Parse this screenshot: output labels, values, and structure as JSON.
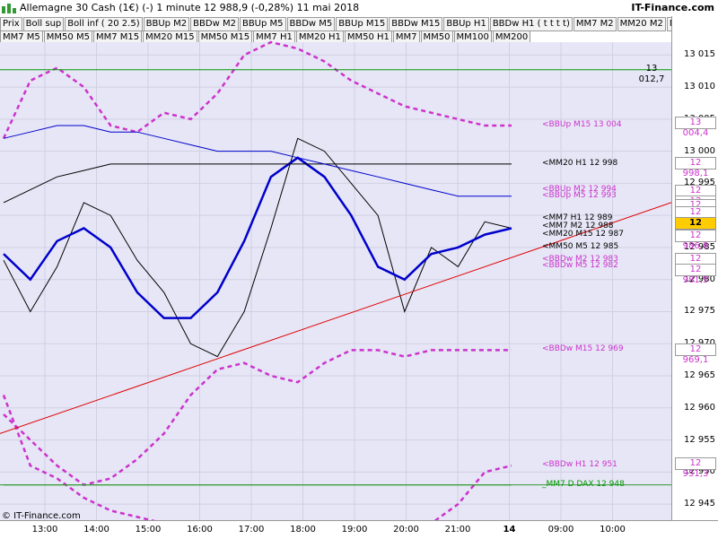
{
  "header": {
    "title": "Allemagne 30 Cash (1€) (-)   1 minute   12 988,9 (-0,28%)   11 mai 2018",
    "brand": "IT-Finance.com"
  },
  "legend_row1": [
    "Prix",
    "Boll sup",
    "Boll inf ( 20 2.5)",
    "BBUp M2",
    "BBDw M2",
    "BBUp M5",
    "BBDw M5",
    "BBUp M15",
    "BBDw M15",
    "BBUp H1",
    "BBDw H1 ( t t t t)",
    "MM7 M2",
    "MM20 M2",
    "MM50 M2"
  ],
  "legend_row2": [
    "MM7 M5",
    "MM50 M5",
    "MM7 M15",
    "MM20 M15",
    "MM50 M15",
    "MM7 H1",
    "MM20 H1",
    "MM50 H1",
    "MM7",
    "MM50",
    "MM100",
    "MM200"
  ],
  "copyright": "© IT-Finance.com",
  "colors": {
    "plot_bg": "#e6e6f6",
    "boll_band_up": "#b08a8a",
    "boll_band_dn": "#a8cfa8",
    "bb_m15": "#cc33cc",
    "mm_blue": "#0000cc",
    "trend_red": "#e00000",
    "hline_green": "#339933",
    "current_price_bg": "#ffcc00"
  },
  "chart_data": {
    "type": "line",
    "title": "Allemagne 30 Cash (1€) (-)",
    "timeframe": "1 minute",
    "last_price": "12 988,9",
    "change_pct": "-0,28%",
    "date": "11 mai 2018",
    "yticks": [
      {
        "label": "13 015",
        "v": 13015
      },
      {
        "label": "13 010",
        "v": 13010
      },
      {
        "label": "13 005",
        "v": 13005
      },
      {
        "label": "13 000",
        "v": 13000
      },
      {
        "label": "12 995",
        "v": 12995
      },
      {
        "label": "12 990",
        "v": 12990
      },
      {
        "label": "12 985",
        "v": 12985
      },
      {
        "label": "12 980",
        "v": 12980
      },
      {
        "label": "12 975",
        "v": 12975
      },
      {
        "label": "12 970",
        "v": 12970
      },
      {
        "label": "12 965",
        "v": 12965
      },
      {
        "label": "12 960",
        "v": 12960
      },
      {
        "label": "12 955",
        "v": 12955
      },
      {
        "label": "12 950",
        "v": 12950
      },
      {
        "label": "12 945",
        "v": 12945
      }
    ],
    "xticks": [
      "13:00",
      "14:00",
      "15:00",
      "16:00",
      "17:00",
      "18:00",
      "19:00",
      "20:00",
      "21:00",
      "14",
      "09:00",
      "10:00"
    ],
    "ylim": [
      12942.5,
      13017.0
    ],
    "right_axis_values": [
      {
        "label": "13 012,7",
        "v": 13012.7
      },
      {
        "label": "13 004,4",
        "v": 13004.4
      },
      {
        "label": "12 998,1",
        "v": 12998.1
      },
      {
        "label": "12 993,8",
        "v": 12993.8
      },
      {
        "label": "12 992,1",
        "v": 12992.1
      },
      {
        "label": "12 992,8",
        "v": 12991.5
      },
      {
        "label": "12 990,4",
        "v": 12990.4
      },
      {
        "label": "12 988,7",
        "v": 12988.7
      },
      {
        "label": "12 986,8",
        "v": 12986.8
      },
      {
        "label": "12 983,2",
        "v": 12983.2
      },
      {
        "label": "12 981,5",
        "v": 12981.5
      },
      {
        "label": "12 969,1",
        "v": 12969.1
      },
      {
        "label": "12 951,3",
        "v": 12951.3
      }
    ],
    "indicator_labels": [
      {
        "text": "<BBUp M15 13 004",
        "v": 13004.0,
        "color": "#cc33cc"
      },
      {
        "text": "<MM20 H1 12 998",
        "v": 12998.0,
        "color": "#000000"
      },
      {
        "text": "<BBUp M2 12 994",
        "v": 12994.0,
        "color": "#cc33cc"
      },
      {
        "text": "<BBUp M5 12 993",
        "v": 12993.0,
        "color": "#cc33cc"
      },
      {
        "text": "<MM7 H1 12 989",
        "v": 12989.4,
        "color": "#000000"
      },
      {
        "text": "<MM7 M2 12 988",
        "v": 12988.2,
        "color": "#000000"
      },
      {
        "text": "<MM20 M15 12 987",
        "v": 12987.0,
        "color": "#000000"
      },
      {
        "text": "<MM50 M5 12 985",
        "v": 12985.0,
        "color": "#000000"
      },
      {
        "text": "<BBDw M2 12 983",
        "v": 12983.0,
        "color": "#cc33cc"
      },
      {
        "text": "<BBDw M5 12 982",
        "v": 12982.0,
        "color": "#cc33cc"
      },
      {
        "text": "<BBDw M15 12 969",
        "v": 12969.0,
        "color": "#cc33cc"
      },
      {
        "text": "<BBDw H1 12 951",
        "v": 12951.0,
        "color": "#cc33cc"
      },
      {
        "text": "_MM7 D DAX   12 948",
        "v": 12948.0,
        "color": "#009900"
      }
    ],
    "series": [
      {
        "name": "BBUp M15",
        "color": "#cc33cc",
        "values": [
          13002,
          13011,
          13013,
          13010,
          13004,
          13003,
          13006,
          13005,
          13009,
          13015,
          13017,
          13016,
          13014,
          13011,
          13009,
          13007,
          13006,
          13005,
          13004,
          13004
        ]
      },
      {
        "name": "BBDw M15",
        "color": "#cc33cc",
        "values": [
          12959,
          12955,
          12951,
          12948,
          12949,
          12952,
          12956,
          12962,
          12966,
          12967,
          12965,
          12964,
          12967,
          12969,
          12969,
          12968,
          12969,
          12969,
          12969,
          12969
        ]
      },
      {
        "name": "BBDw H1",
        "color": "#cc33cc",
        "values": [
          12962,
          12951,
          12949,
          12946,
          12944,
          12943,
          12942,
          12941,
          12941,
          12940,
          12940,
          12939,
          12939,
          12939,
          12939,
          12940,
          12942,
          12945,
          12950,
          12951
        ]
      },
      {
        "name": "Prix",
        "color": "#000000",
        "values": [
          12983,
          12975,
          12982,
          12992,
          12990,
          12983,
          12978,
          12970,
          12968,
          12975,
          12988,
          13002,
          13000,
          12995,
          12990,
          12975,
          12985,
          12982,
          12989,
          12988
        ]
      },
      {
        "name": "MM20 M2",
        "color": "#0000cc",
        "values": [
          12984,
          12980,
          12986,
          12988,
          12985,
          12978,
          12974,
          12974,
          12978,
          12986,
          12996,
          12999,
          12996,
          12990,
          12982,
          12980,
          12984,
          12985,
          12987,
          12988
        ]
      },
      {
        "name": "MM20 H1",
        "color": "#000000",
        "values": [
          12992,
          12994,
          12996,
          12997,
          12998,
          12998,
          12998,
          12998,
          12998,
          12998,
          12998,
          12998,
          12998,
          12998,
          12998,
          12998,
          12998,
          12998,
          12998,
          12998
        ]
      },
      {
        "name": "MM50 H1",
        "color": "#0000cc",
        "values": [
          13002,
          13003,
          13004,
          13004,
          13003,
          13003,
          13002,
          13001,
          13000,
          13000,
          13000,
          12999,
          12998,
          12997,
          12996,
          12995,
          12994,
          12993,
          12993,
          12993
        ]
      },
      {
        "name": "MM7 D DAX",
        "color": "#009900",
        "values": [
          12948,
          12948,
          12948,
          12948,
          12948,
          12948,
          12948,
          12948,
          12948,
          12948,
          12948,
          12948,
          12948,
          12948,
          12948,
          12948,
          12948,
          12948,
          12948,
          12948
        ]
      }
    ],
    "trendline": {
      "color": "#e00000",
      "from": {
        "t": "12:40",
        "v": 12956
      },
      "to": {
        "t": "10:40",
        "v": 12992
      }
    }
  }
}
